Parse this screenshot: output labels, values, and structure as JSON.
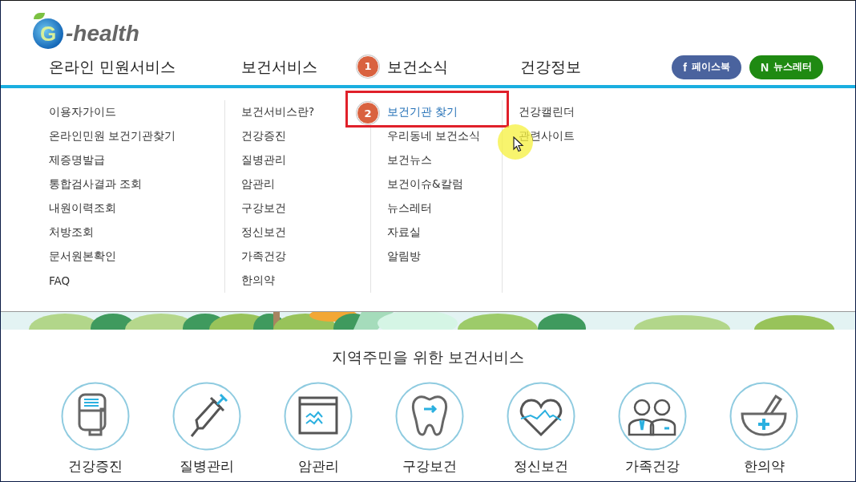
{
  "logo": {
    "letter": "G",
    "text": "-health"
  },
  "nav": [
    {
      "label": "온라인 민원서비스"
    },
    {
      "label": "보건서비스"
    },
    {
      "label": "보건소식",
      "step": "1"
    },
    {
      "label": "건강정보"
    }
  ],
  "social_buttons": [
    {
      "kind": "facebook",
      "glyph": "f",
      "label": "페이스북"
    },
    {
      "kind": "newsletter",
      "glyph": "N",
      "label": "뉴스레터"
    }
  ],
  "dropdown": [
    {
      "items": [
        {
          "label": "이용자가이드",
          "selected": false
        },
        {
          "label": "온라인민원 보건기관찾기",
          "selected": false
        },
        {
          "label": "제증명발급",
          "selected": false
        },
        {
          "label": "통합검사결과 조회",
          "selected": false
        },
        {
          "label": "내원이력조회",
          "selected": false
        },
        {
          "label": "처방조회",
          "selected": false
        },
        {
          "label": "문서원본확인",
          "selected": false
        },
        {
          "label": "FAQ",
          "selected": false
        }
      ]
    },
    {
      "items": [
        {
          "label": "보건서비스란?",
          "selected": false
        },
        {
          "label": "건강증진",
          "selected": false
        },
        {
          "label": "질병관리",
          "selected": false
        },
        {
          "label": "암관리",
          "selected": false
        },
        {
          "label": "구강보건",
          "selected": false
        },
        {
          "label": "정신보건",
          "selected": false
        },
        {
          "label": "가족건강",
          "selected": false
        },
        {
          "label": "한의약",
          "selected": false
        }
      ]
    },
    {
      "items": [
        {
          "label": "보건기관 찾기",
          "selected": true,
          "step": "2"
        },
        {
          "label": "우리동네 보건소식",
          "selected": false
        },
        {
          "label": "보건뉴스",
          "selected": false
        },
        {
          "label": "보건이슈&칼럼",
          "selected": false
        },
        {
          "label": "뉴스레터",
          "selected": false
        },
        {
          "label": "자료실",
          "selected": false
        },
        {
          "label": "알림방",
          "selected": false
        }
      ]
    },
    {
      "items": [
        {
          "label": "건강캘린더",
          "selected": false
        },
        {
          "label": "관련사이트",
          "selected": false
        }
      ]
    }
  ],
  "services": {
    "title": "지역주민을 위한 보건서비스",
    "items": [
      {
        "label": "건강증진"
      },
      {
        "label": "질병관리"
      },
      {
        "label": "암관리"
      },
      {
        "label": "구강보건"
      },
      {
        "label": "정신보건"
      },
      {
        "label": "가족건강"
      },
      {
        "label": "한의약"
      }
    ]
  }
}
